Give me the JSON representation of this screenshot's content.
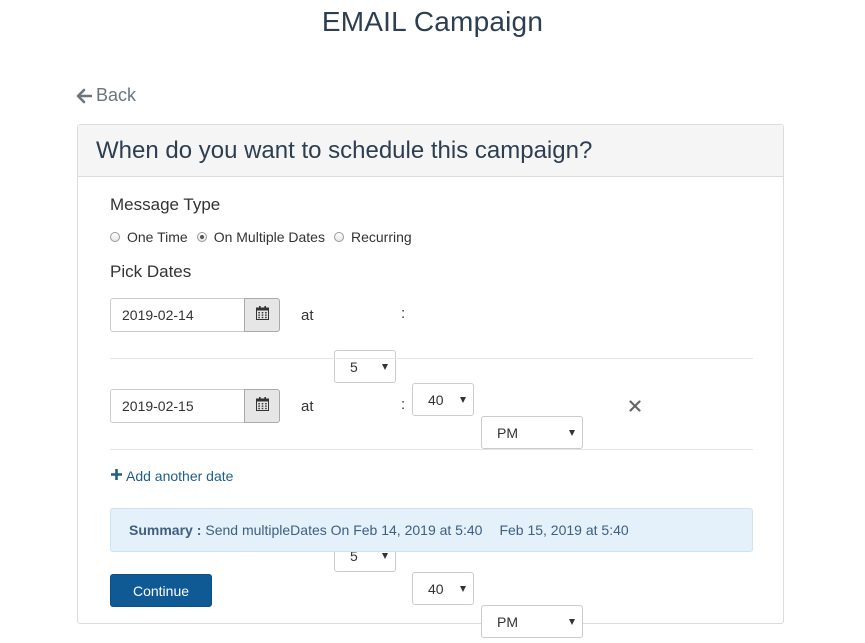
{
  "page": {
    "title": "EMAIL Campaign"
  },
  "back": {
    "label": "Back",
    "icon": "arrow-left-icon"
  },
  "card": {
    "title": "When do you want to schedule this campaign?"
  },
  "message_type": {
    "label": "Message Type",
    "options": [
      {
        "label": "One Time",
        "checked": false
      },
      {
        "label": "On Multiple Dates",
        "checked": true
      },
      {
        "label": "Recurring",
        "checked": false
      }
    ]
  },
  "pick_dates": {
    "label": "Pick Dates",
    "at_label": "at",
    "colon": ":",
    "rows": [
      {
        "date": "2019-02-14",
        "hour": "5",
        "minute": "40",
        "meridiem": "PM",
        "removable": false
      },
      {
        "date": "2019-02-15",
        "hour": "5",
        "minute": "40",
        "meridiem": "PM",
        "removable": true
      }
    ]
  },
  "add_date": {
    "label": "Add another date"
  },
  "summary": {
    "label": "Summary :",
    "text": "Send multipleDates On Feb 14, 2019 at 5:40",
    "text2": "Feb 15, 2019 at 5:40"
  },
  "continue": {
    "label": "Continue"
  },
  "colors": {
    "accent": "#0f5a94",
    "link": "#1f5e8c",
    "summary_bg": "#e4f0fa",
    "header_bg": "#f5f5f5"
  }
}
